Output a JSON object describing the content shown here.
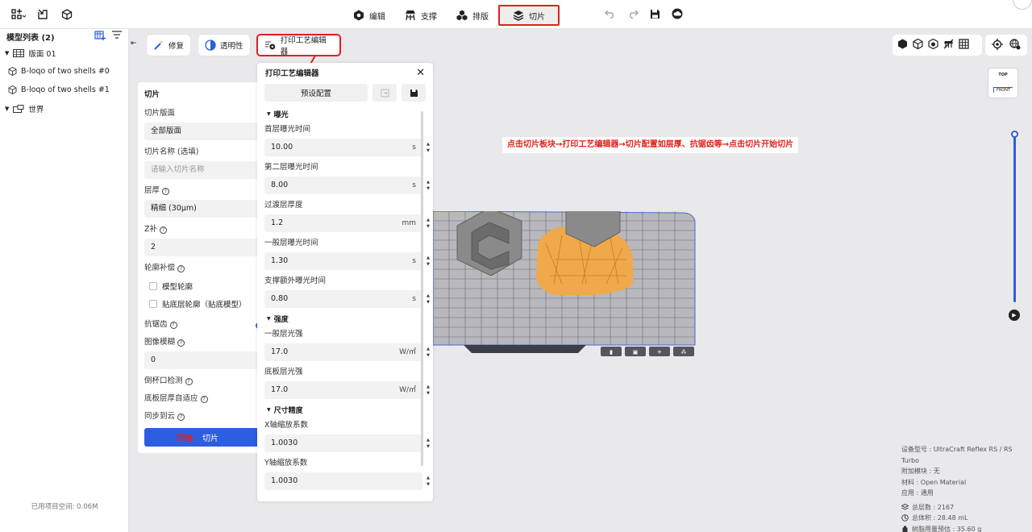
{
  "topbar": {
    "tabs": [
      {
        "label": "编辑",
        "icon": "hexagon-edit-icon"
      },
      {
        "label": "支撑",
        "icon": "support-icon"
      },
      {
        "label": "排版",
        "icon": "layout-icon"
      },
      {
        "label": "切片",
        "icon": "layers-icon",
        "active": true
      }
    ]
  },
  "sidebar": {
    "title": "模型列表 (2)",
    "items": [
      {
        "label": "版面 01",
        "icon": "grid-plate-icon",
        "level": 0
      },
      {
        "label": "B-loqo of two shells #0",
        "icon": "cube-icon",
        "level": 1
      },
      {
        "label": "B-loqo of two shells #1",
        "icon": "cube-icon",
        "level": 1
      },
      {
        "label": "世界",
        "icon": "world-icon",
        "level": 0
      }
    ],
    "footer": "已用项目空间: 0.06M"
  },
  "toolbar": {
    "repair_label": "修复",
    "transparency_label": "透明性",
    "editor_label": "打印工艺编辑器"
  },
  "slice_panel": {
    "title": "切片",
    "plate_label": "切片版面",
    "plate_value": "全部版面",
    "name_label": "切片名称 (选填)",
    "name_placeholder": "请输入切片名称",
    "layer_label": "层厚",
    "layer_value": "精细 (30μm)",
    "z_label": "Z补",
    "z_value": "2",
    "contour_label": "轮廓补偿",
    "contour_model": "模型轮廓",
    "contour_base": "贴底层轮廓（贴底模型）",
    "aa_label": "抗锯齿",
    "blur_label": "图像模糊",
    "blur_value": "0",
    "cup_label": "倒杯口检测",
    "base_adapt_label": "底板层厚自适应",
    "cloud_label": "同步到云",
    "start_red": "开始",
    "start_label": "切片"
  },
  "editor": {
    "title": "打印工艺编辑器",
    "preset_label": "预设配置",
    "sections": {
      "exposure": "曝光",
      "strength": "强度",
      "precision": "尺寸精度"
    },
    "fields": [
      {
        "label": "首层曝光时间",
        "value": "10.00",
        "unit": "s"
      },
      {
        "label": "第二层曝光时间",
        "value": "8.00",
        "unit": "s"
      },
      {
        "label": "过渡层厚度",
        "value": "1.2",
        "unit": "mm"
      },
      {
        "label": "一般层曝光时间",
        "value": "1.30",
        "unit": "s"
      },
      {
        "label": "支撑额外曝光时间",
        "value": "0.80",
        "unit": "s"
      },
      {
        "label": "一般层光强",
        "value": "17.0",
        "unit": "W/㎡"
      },
      {
        "label": "底板层光强",
        "value": "17.0",
        "unit": "W/㎡"
      },
      {
        "label": "X轴缩放系数",
        "value": "1.0030",
        "unit": ""
      },
      {
        "label": "Y轴缩放系数",
        "value": "1.0030",
        "unit": ""
      }
    ]
  },
  "annotation": "点击切片板块→打印工艺编辑器→切片配置如层厚、抗锯齿等→点击切片开始切片",
  "gizmo": {
    "top": "TOP",
    "front": "FRONT"
  },
  "device": {
    "model": "设备型号 : UltraCraft Reflex RS / RS Turbo",
    "addon": "附加模块 : 无",
    "material": "材料 : Open Material",
    "application": "应用 : 通用",
    "layers": "总层数 : 2167",
    "volume": "总体积 : 28.48 mL",
    "resin": "树脂用量预估 : 35.60 g"
  },
  "colors": {
    "accent": "#2d5de0",
    "highlight": "#e0211d",
    "support": "#f0a94a",
    "model": "#8a8a8a"
  }
}
